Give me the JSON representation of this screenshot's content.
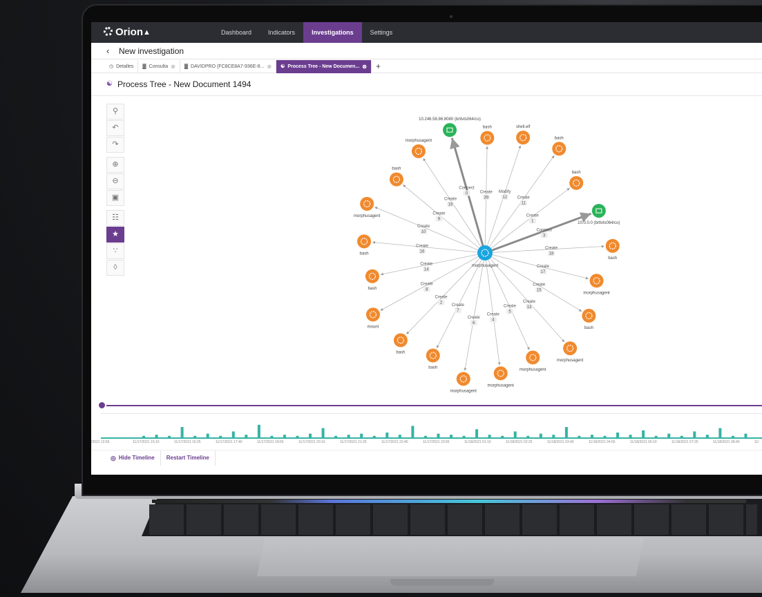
{
  "app": {
    "name": "Orion"
  },
  "nav": [
    {
      "label": "Dashboard",
      "active": false
    },
    {
      "label": "Indicators",
      "active": false
    },
    {
      "label": "Investigations",
      "active": true
    },
    {
      "label": "Settings",
      "active": false
    }
  ],
  "header": {
    "title": "New investigation"
  },
  "tabs": [
    {
      "label": "Detalles",
      "active": false
    },
    {
      "label": "Consulta",
      "active": false
    },
    {
      "label": "DAVIDPRO (FC8CE8A7-936E-8...",
      "active": false
    },
    {
      "label": "Process Tree - New Documen...",
      "active": true
    }
  ],
  "page": {
    "title": "Process Tree - New Document 1494"
  },
  "colors": {
    "accent": "#6b3d8f",
    "node": "#f08a2e",
    "center": "#1aa5e0",
    "network": "#2bb35a",
    "timeline": "#35b3a5"
  },
  "tools": [
    "search-icon",
    "undo-icon",
    "redo-icon",
    "zoom-in-icon",
    "zoom-out-icon",
    "fit-icon",
    "hierarchy-icon",
    "radial-layout-icon",
    "tree-layout-icon",
    "layers-icon"
  ],
  "graph": {
    "center": {
      "label": "morphusagent"
    },
    "nodes": [
      {
        "label": "bash",
        "edge": "Create",
        "count": "39"
      },
      {
        "label": "shell.elf",
        "edge": "Modify",
        "count": "12"
      },
      {
        "label": "bash",
        "edge": "Create",
        "count": "11"
      },
      {
        "label": "bash",
        "edge": "Create",
        "count": "1"
      },
      {
        "label": "10.0.0.0 (brtlvts064/co)",
        "edge": "Connect",
        "count": "3",
        "type": "network"
      },
      {
        "label": "bash",
        "edge": "Create",
        "count": "18"
      },
      {
        "label": "morphusagent",
        "edge": "Create",
        "count": "17"
      },
      {
        "label": "bash",
        "edge": "Create",
        "count": "15"
      },
      {
        "label": "morphusagent",
        "edge": "Create",
        "count": "13"
      },
      {
        "label": "morphusagent",
        "edge": "Create",
        "count": "5"
      },
      {
        "label": "morphusagent",
        "edge": "Create",
        "count": "4"
      },
      {
        "label": "morphusagent",
        "edge": "Create",
        "count": "6"
      },
      {
        "label": "bash",
        "edge": "Create",
        "count": "7"
      },
      {
        "label": "bash",
        "edge": "Create",
        "count": "2"
      },
      {
        "label": "mount",
        "edge": "Create",
        "count": "8"
      },
      {
        "label": "bash",
        "edge": "Create",
        "count": "14"
      },
      {
        "label": "bash",
        "edge": "Create",
        "count": "16"
      },
      {
        "label": "morphusagent",
        "edge": "Create",
        "count": "10"
      },
      {
        "label": "bash",
        "edge": "Create",
        "count": "9"
      },
      {
        "label": "morphusagent",
        "edge": "Create",
        "count": "19"
      },
      {
        "label": "10.246.58.86:8080 (brtlvts064/co)",
        "edge": "Connect",
        "count": "0",
        "type": "network"
      }
    ]
  },
  "timeline": {
    "labels": [
      "/2021 13:55",
      "11/17/2021 15:10",
      "11/17/2021 16:25",
      "11/17/2021 17:40",
      "11/17/2021 18:55",
      "11/17/2021 20:10",
      "11/17/2021 21:25",
      "11/17/2021 22:40",
      "11/17/2021 23:55",
      "11/18/2021 01:10",
      "11/18/2021 02:25",
      "11/18/2021 03:40",
      "11/18/2021 04:55",
      "11/18/2021 06:10",
      "11/18/2021 07:25",
      "11/18/2021 08:40",
      "11/"
    ],
    "hide_label": "Hide Timeline",
    "restart_label": "Restart Timeline"
  }
}
